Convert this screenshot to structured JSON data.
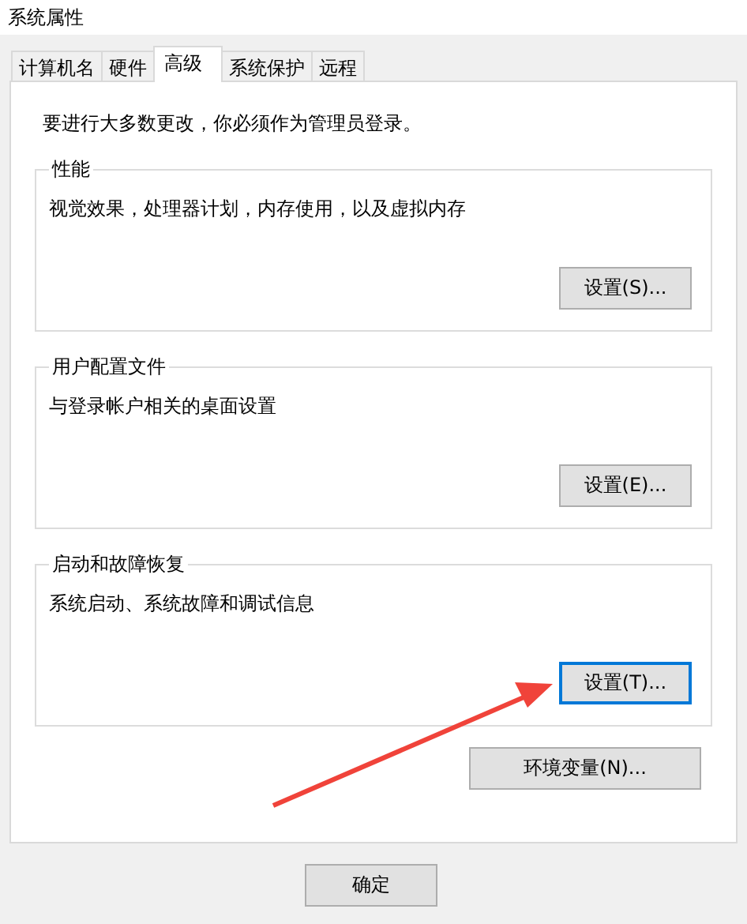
{
  "window": {
    "title": "系统属性"
  },
  "tabs": [
    {
      "label": "计算机名",
      "selected": false
    },
    {
      "label": "硬件",
      "selected": false
    },
    {
      "label": "高级",
      "selected": true
    },
    {
      "label": "系统保护",
      "selected": false
    },
    {
      "label": "远程",
      "selected": false
    }
  ],
  "notice": "要进行大多数更改，你必须作为管理员登录。",
  "groups": [
    {
      "title": "性能",
      "description": "视觉效果，处理器计划，内存使用，以及虚拟内存",
      "button": {
        "label": "设置(S)...",
        "focused": false
      }
    },
    {
      "title": "用户配置文件",
      "description": "与登录帐户相关的桌面设置",
      "button": {
        "label": "设置(E)...",
        "focused": false
      }
    },
    {
      "title": "启动和故障恢复",
      "description": "系统启动、系统故障和调试信息",
      "button": {
        "label": "设置(T)...",
        "focused": true
      }
    }
  ],
  "env_button": "环境变量(N)...",
  "dialog_buttons": [
    "确定"
  ]
}
